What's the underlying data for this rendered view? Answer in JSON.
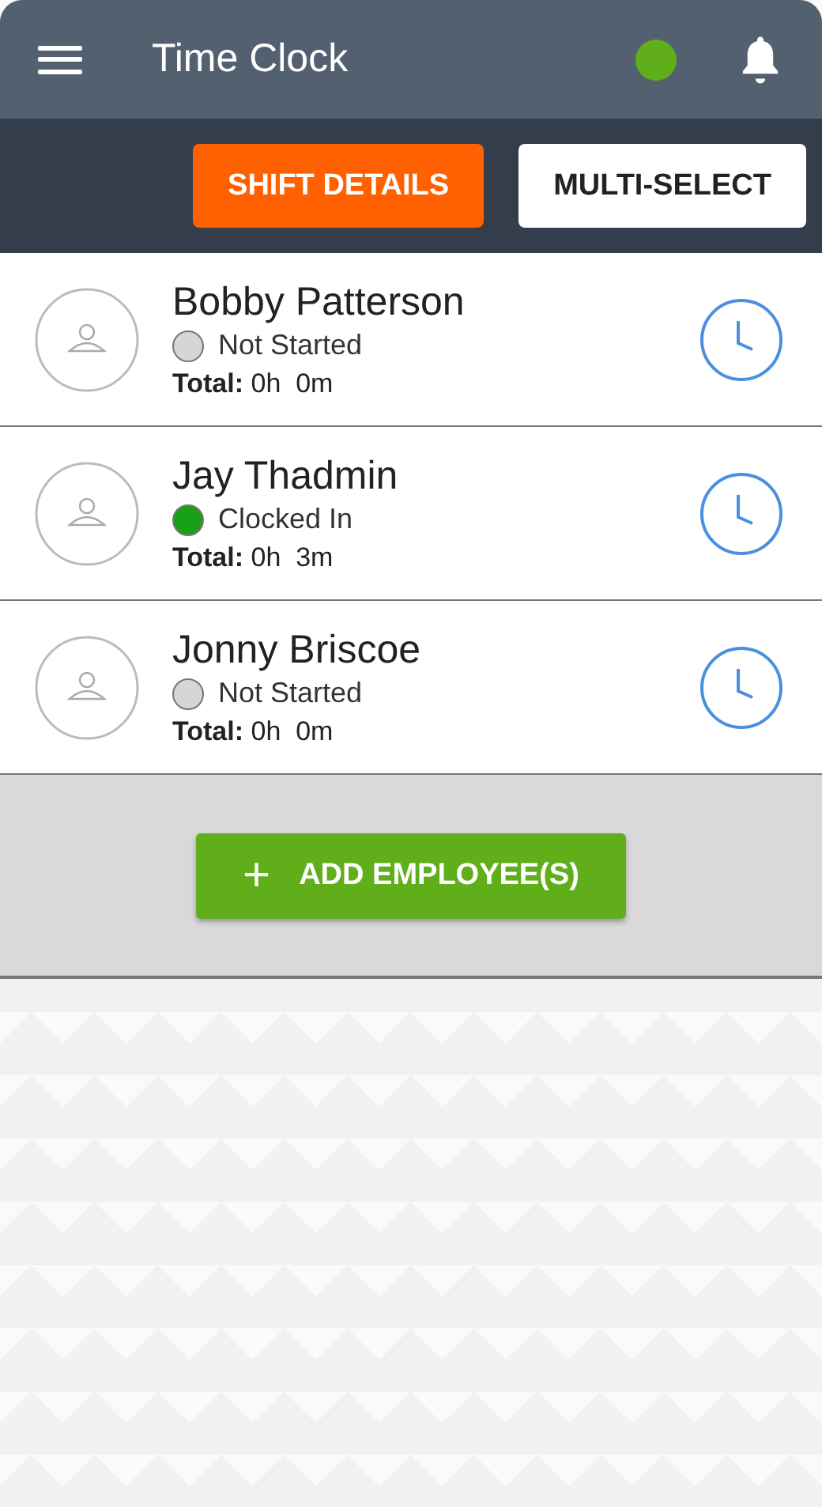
{
  "header": {
    "title": "Time Clock",
    "online": true
  },
  "toolbar": {
    "buttons": [
      {
        "label": "SHIFT DETAILS",
        "kind": "primary"
      },
      {
        "label": "MULTI-SELECT",
        "kind": "secondary"
      }
    ]
  },
  "employees": [
    {
      "name": "Bobby Patterson",
      "status": "Not Started",
      "color": "#d6d6d6",
      "total_label": "Total:",
      "total": "0h  0m"
    },
    {
      "name": "Jay Thadmin",
      "status": "Clocked In",
      "color": "#18a018",
      "total_label": "Total:",
      "total": "0h  3m"
    },
    {
      "name": "Jonny Briscoe",
      "status": "Not Started",
      "color": "#d6d6d6",
      "total_label": "Total:",
      "total": "0h  0m"
    }
  ],
  "add_button": {
    "icon": "+",
    "label": "ADD EMPLOYEE(S)"
  }
}
